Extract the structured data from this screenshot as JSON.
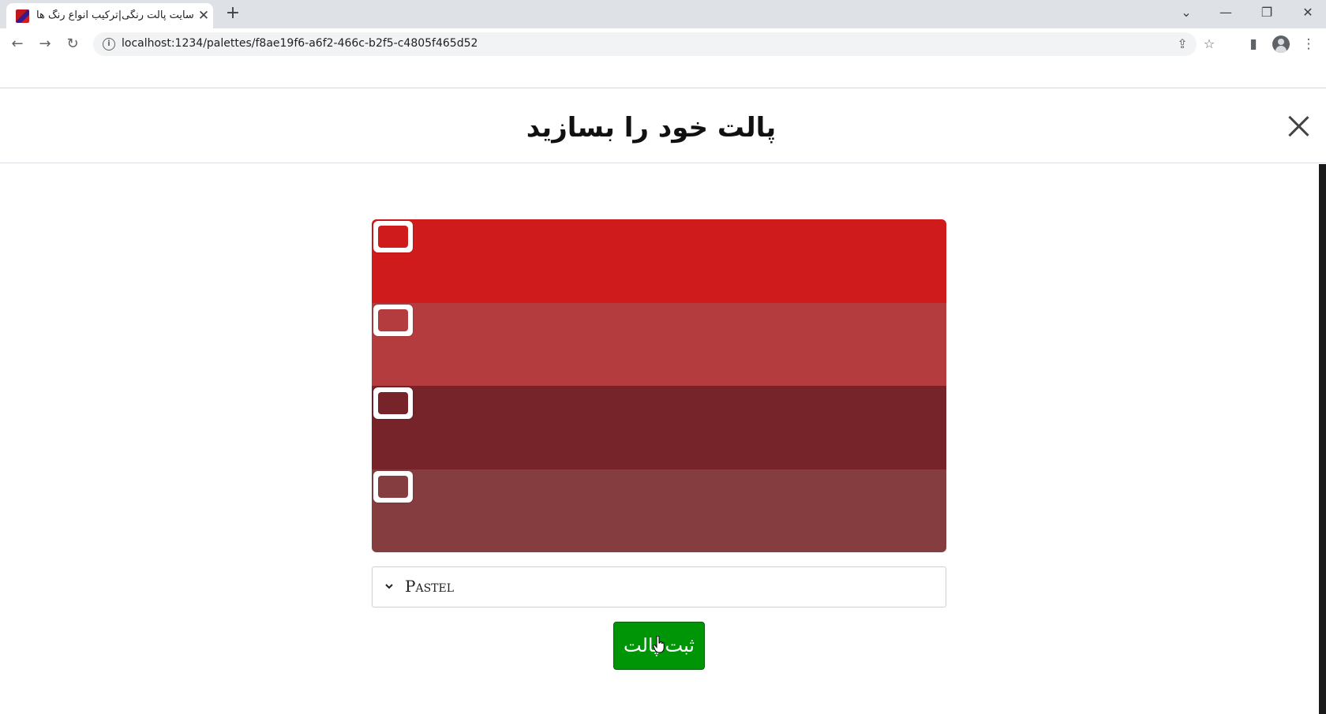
{
  "browser": {
    "tab_title": "سایت پالت رنگی|ترکیب انواع رنگ ها",
    "tab_close_glyph": "✕",
    "new_tab_glyph": "+",
    "url": "localhost:1234/palettes/f8ae19f6-a6f2-466c-b2f5-c4805f465d52",
    "controls": {
      "tab_list_glyph": "⌄",
      "minimize_glyph": "—",
      "restore_glyph": "❐",
      "close_glyph": "✕"
    },
    "nav": {
      "back_glyph": "←",
      "forward_glyph": "→",
      "reload_glyph": "↻",
      "info_glyph": "i"
    },
    "icons": {
      "share_glyph": "⇪",
      "star_glyph": "☆",
      "sidepanel_glyph": "▮",
      "menu_glyph": "⋮"
    }
  },
  "modal": {
    "title": "پالت خود را بسازید",
    "close_icon": "close-icon"
  },
  "palette": {
    "swatches": [
      {
        "color": "#d01b1d"
      },
      {
        "color": "#b43c3f"
      },
      {
        "color": "#76232a"
      },
      {
        "color": "#853d40"
      }
    ]
  },
  "category_select": {
    "selected": "Pastel",
    "icon": "chevron-down-icon"
  },
  "save_button": {
    "label": "ثبت پالت",
    "color": "#009407"
  }
}
